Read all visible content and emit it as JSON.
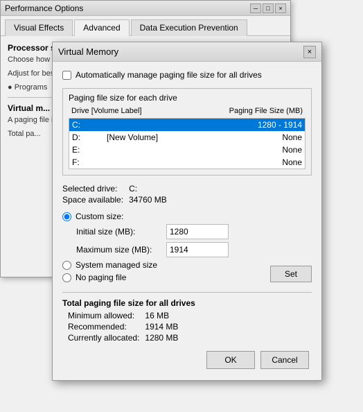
{
  "perfOptions": {
    "title": "Performance Options",
    "tabs": [
      {
        "label": "Visual Effects",
        "active": false
      },
      {
        "label": "Advanced",
        "active": true
      },
      {
        "label": "Data Execution Prevention",
        "active": false
      }
    ],
    "processorLabel": "Processor scheduling",
    "chooseText": "Choose how to allocate processor resources.",
    "adjustText": "Adjust for best performance of:",
    "progText": "● Programs",
    "virtualMemLabel": "Virtual m...",
    "pagingText": "A paging file is an area on the hard disk that Windows uses as if it were RAM.",
    "totalPageText": "Total pa..."
  },
  "vmDialog": {
    "title": "Virtual Memory",
    "closeBtn": "×",
    "autoManageLabel": "Automatically manage paging file size for all drives",
    "groupHeader": "Paging file size for each drive",
    "tableHeaders": {
      "drive": "Drive  [Volume Label]",
      "pagingSize": "Paging File Size (MB)"
    },
    "drives": [
      {
        "drive": "C:",
        "label": "",
        "size": "1280 - 1914",
        "selected": true
      },
      {
        "drive": "D:",
        "label": "[New Volume]",
        "size": "None",
        "selected": false
      },
      {
        "drive": "E:",
        "label": "",
        "size": "None",
        "selected": false
      },
      {
        "drive": "F:",
        "label": "",
        "size": "None",
        "selected": false
      }
    ],
    "selectedDriveLabel": "Selected drive:",
    "selectedDriveValue": "C:",
    "spaceAvailLabel": "Space available:",
    "spaceAvailValue": "34760 MB",
    "customSizeLabel": "Custom size:",
    "initialSizeLabel": "Initial size (MB):",
    "initialSizeValue": "1280",
    "maxSizeLabel": "Maximum size (MB):",
    "maxSizeValue": "1914",
    "sysManagedLabel": "System managed size",
    "noPagingLabel": "No paging file",
    "setBtnLabel": "Set",
    "totalSectionTitle": "Total paging file size for all drives",
    "minAllowedLabel": "Minimum allowed:",
    "minAllowedValue": "16 MB",
    "recommendedLabel": "Recommended:",
    "recommendedValue": "1914 MB",
    "currentlyAllocLabel": "Currently allocated:",
    "currentlyAllocValue": "1280 MB",
    "okBtn": "OK",
    "cancelBtn": "Cancel"
  },
  "titleControls": {
    "minimize": "─",
    "maximize": "□",
    "close": "×"
  }
}
